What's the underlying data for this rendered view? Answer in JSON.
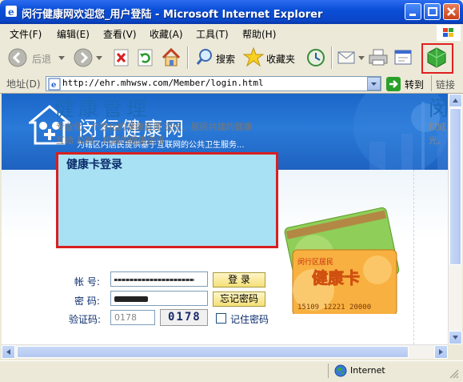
{
  "window": {
    "title": "闵行健康网欢迎您_用户登陆 - Microsoft Internet Explorer"
  },
  "menu": [
    "文件(F)",
    "编辑(E)",
    "查看(V)",
    "收藏(A)",
    "工具(T)",
    "帮助(H)"
  ],
  "toolbar": {
    "back_label": "后退",
    "search_label": "搜索",
    "favorites_label": "收藏夹"
  },
  "address": {
    "label": "地址(D)",
    "url": "http://ehr.mhwsw.com/Member/login.html",
    "go_label": "转到",
    "links_label": "链接"
  },
  "site": {
    "title": "闵行健康网",
    "subtitle": "为辖区内居民提供基于互联网的公共卫生服务..."
  },
  "section": {
    "title": "健康管理",
    "desc_line1": "专业化、个性化的健康管理  医生、居民共建的健康",
    "desc_line2": "互动  及时、权威的健康资讯"
  },
  "right_panel": {
    "title": "闵",
    "desc_line1": "权威",
    "desc_line2": "光、"
  },
  "login": {
    "title": "健康卡登录",
    "account_label": "帐  号:",
    "password_label": "密  码:",
    "captcha_label": "验证码:",
    "captcha_value": "0178",
    "captcha_image_text": "0178",
    "login_button": "登  录",
    "forgot_button": "忘记密码",
    "remember_label": "记住密码"
  },
  "card": {
    "title": "健康卡",
    "top_text": "闵行区居民",
    "number": "15109 12221 20000"
  },
  "status": {
    "zone": "Internet"
  },
  "colors": {
    "accent": "#1c6ab8",
    "panel": "#a9e1f4",
    "highlight": "#d82020"
  }
}
